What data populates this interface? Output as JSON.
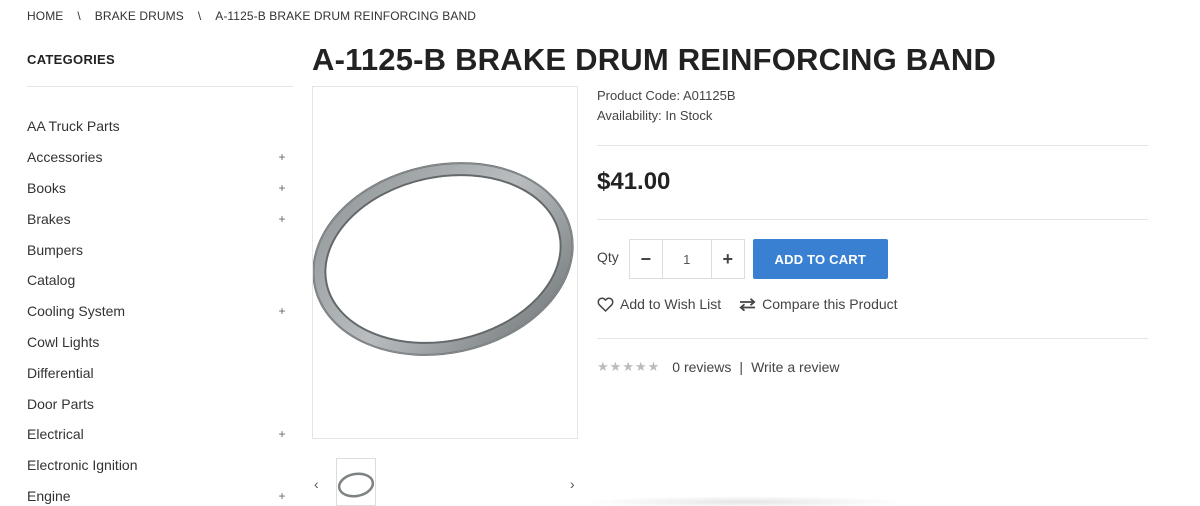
{
  "breadcrumb": {
    "items": [
      "HOME",
      "BRAKE DRUMS",
      "A-1125-B BRAKE DRUM REINFORCING BAND"
    ],
    "separator": "\\"
  },
  "sidebar": {
    "title": "CATEGORIES",
    "categories": [
      {
        "label": "AA Truck Parts",
        "expand": ""
      },
      {
        "label": "Accessories",
        "expand": "+"
      },
      {
        "label": "Books",
        "expand": "+"
      },
      {
        "label": "Brakes",
        "expand": "+"
      },
      {
        "label": "Bumpers",
        "expand": ""
      },
      {
        "label": "Catalog",
        "expand": ""
      },
      {
        "label": "Cooling System",
        "expand": "+"
      },
      {
        "label": "Cowl Lights",
        "expand": ""
      },
      {
        "label": "Differential",
        "expand": ""
      },
      {
        "label": "Door Parts",
        "expand": ""
      },
      {
        "label": "Electrical",
        "expand": "+"
      },
      {
        "label": "Electronic Ignition",
        "expand": ""
      },
      {
        "label": "Engine",
        "expand": "+"
      }
    ]
  },
  "product": {
    "title": "A-1125-B BRAKE DRUM REINFORCING BAND",
    "code_line": "Product Code: A01125B",
    "availability_line": "Availability: In Stock",
    "price": "$41.00",
    "qty_label": "Qty",
    "qty_value": "1",
    "qty_minus": "−",
    "qty_plus": "+",
    "add_to_cart": "ADD TO CART",
    "wishlist": "Add to Wish List",
    "compare": "Compare this Product",
    "reviews_count": "0 reviews",
    "review_separator": "|",
    "write_review": "Write a review",
    "rating": 0,
    "rating_max": 5
  },
  "gallery": {
    "prev": "‹",
    "next": "›"
  },
  "colors": {
    "accent": "#3a80d2",
    "text": "#333333",
    "divider": "#e5e5e5",
    "star": "#bbbbbb"
  }
}
